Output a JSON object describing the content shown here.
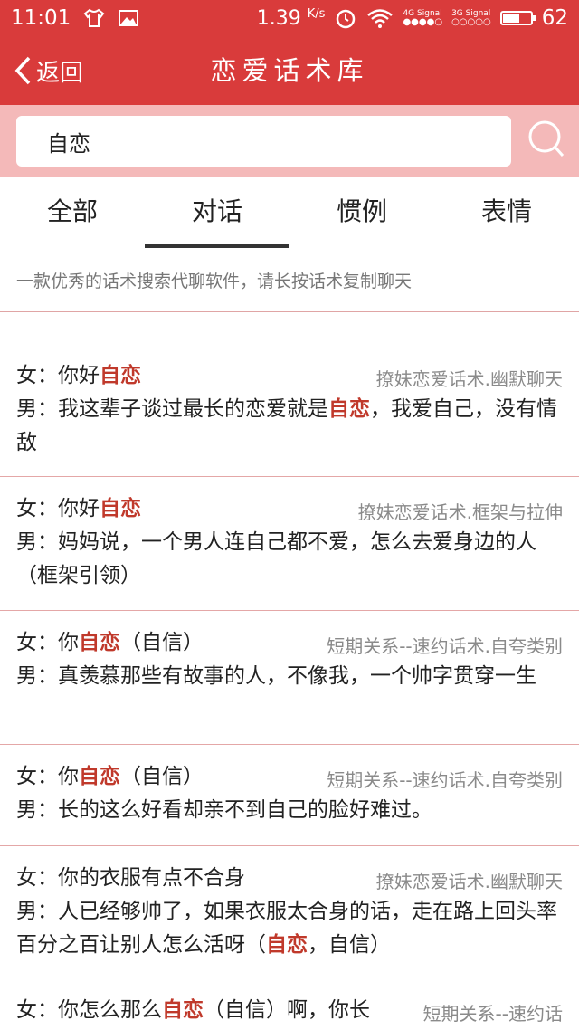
{
  "status": {
    "time": "11:01",
    "speed": "1.39",
    "speed_unit": "K/s",
    "net1": "4G",
    "net1_label": "Signal",
    "net2": "3G",
    "net2_label": "Signal",
    "battery": "62",
    "battery_level": 0.62
  },
  "nav": {
    "back_label": "返回",
    "title": "恋爱话术库"
  },
  "search": {
    "value": "自恋"
  },
  "tabs": [
    {
      "label": "全部"
    },
    {
      "label": "对话"
    },
    {
      "label": "惯例"
    },
    {
      "label": "表情"
    }
  ],
  "notice": "一款优秀的话术搜索代聊软件，请长按话术复制聊天",
  "results": [
    {
      "tag": "撩妹恋爱话术.幽默聊天",
      "f_prefix": "女：你好",
      "f_hl": "自恋",
      "f_suffix": "",
      "m_prefix": "男：我这辈子谈过最长的恋爱就是",
      "m_hl": "自恋",
      "m_suffix": "，我爱自己，没有情敌"
    },
    {
      "tag": "撩妹恋爱话术.框架与拉伸",
      "f_prefix": "女：你好",
      "f_hl": "自恋",
      "f_suffix": "",
      "m_prefix": "男：妈妈说，一个男人连自己都不爱，怎么去爱身边的人（框架引领）",
      "m_hl": "",
      "m_suffix": ""
    },
    {
      "tag": "短期关系--速约话术.自夸类别",
      "f_prefix": "女：你",
      "f_hl": "自恋",
      "f_suffix": "（自信）",
      "m_prefix": "男：真羡慕那些有故事的人，不像我，一个帅字贯穿一生",
      "m_hl": "",
      "m_suffix": ""
    },
    {
      "tag": "短期关系--速约话术.自夸类别",
      "f_prefix": "女：你",
      "f_hl": "自恋",
      "f_suffix": "（自信）",
      "m_prefix": "男：长的这么好看却亲不到自己的脸好难过。",
      "m_hl": "",
      "m_suffix": ""
    },
    {
      "tag": "撩妹恋爱话术.幽默聊天",
      "f_prefix": "女：你的衣服有点不合身",
      "f_hl": "",
      "f_suffix": "",
      "m_prefix": "男：人已经够帅了，如果衣服太合身的话，走在路上回头率百分之百让别人怎么活呀（",
      "m_hl": "自恋",
      "m_suffix": "，自信）"
    },
    {
      "tag": "短期关系--速约话",
      "f_prefix": "女：你怎么那么",
      "f_hl": "自恋",
      "f_suffix": "（自信）啊，你长",
      "m_prefix": "",
      "m_hl": "",
      "m_suffix": ""
    }
  ],
  "colors": {
    "primary": "#d93b3b",
    "search_bg": "#f4b9b9",
    "highlight": "#c0392b"
  }
}
